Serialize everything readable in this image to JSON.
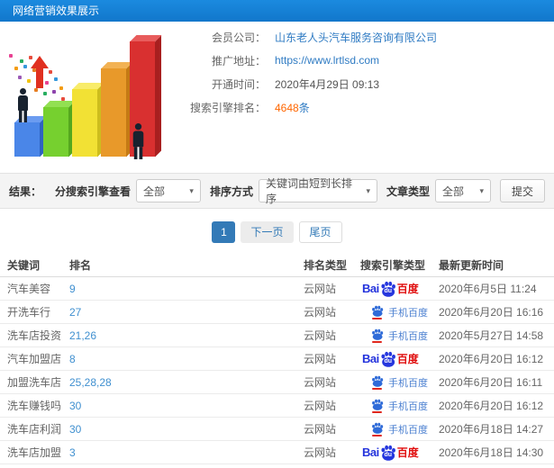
{
  "header": {
    "title": "网络营销效果展示"
  },
  "info": {
    "member": {
      "label": "会员公司：",
      "value": "山东老人头汽车服务咨询有限公司"
    },
    "url": {
      "label": "推广地址：",
      "value": "https://www.lrtlsd.com"
    },
    "open_time": {
      "label": "开通时间：",
      "value": "2020年4月29日 09:13"
    },
    "rank": {
      "label": "搜索引擎排名：",
      "value": "4648",
      "unit": "条"
    }
  },
  "filters": {
    "section_label": "结果：",
    "engine": {
      "label": "分搜索引擎查看",
      "selected": "全部"
    },
    "sort": {
      "label": "排序方式",
      "selected": "关键词由短到长排序"
    },
    "article": {
      "label": "文章类型",
      "selected": "全部"
    },
    "submit_label": "提交",
    "caret": "▾"
  },
  "pagination": {
    "current": "1",
    "next_label": "下一页",
    "last_label": "尾页"
  },
  "logos": {
    "baidu": {
      "bai": "Bai",
      "du": "du",
      "cn": "百度"
    },
    "mobile_baidu": {
      "label": "手机百度"
    }
  },
  "colors": {
    "header_blue": "#1581d6",
    "link_blue": "#2f7bc3",
    "accent_orange": "#ff6600",
    "baidu_blue": "#2433dc",
    "baidu_red": "#e00d0d",
    "active_page_blue": "#337ab7"
  },
  "table": {
    "columns": [
      "关键词",
      "排名",
      "排名类型",
      "搜索引擎类型",
      "最新更新时间"
    ],
    "rows": [
      {
        "keyword": "汽车美容",
        "rank": "9",
        "rank_type": "云网站",
        "engine": "baidu",
        "updated": "2020年6月5日 11:24"
      },
      {
        "keyword": "开洗车行",
        "rank": "27",
        "rank_type": "云网站",
        "engine": "mobile-baidu",
        "updated": "2020年6月20日 16:16"
      },
      {
        "keyword": "洗车店投资",
        "rank": "21,26",
        "rank_type": "云网站",
        "engine": "mobile-baidu",
        "updated": "2020年5月27日 14:58"
      },
      {
        "keyword": "汽车加盟店",
        "rank": "8",
        "rank_type": "云网站",
        "engine": "baidu",
        "updated": "2020年6月20日 16:12"
      },
      {
        "keyword": "加盟洗车店",
        "rank": "25,28,28",
        "rank_type": "云网站",
        "engine": "mobile-baidu",
        "updated": "2020年6月20日 16:11"
      },
      {
        "keyword": "洗车赚钱吗",
        "rank": "30",
        "rank_type": "云网站",
        "engine": "mobile-baidu",
        "updated": "2020年6月20日 16:12"
      },
      {
        "keyword": "洗车店利润",
        "rank": "30",
        "rank_type": "云网站",
        "engine": "mobile-baidu",
        "updated": "2020年6月18日 14:27"
      },
      {
        "keyword": "洗车店加盟",
        "rank": "3",
        "rank_type": "云网站",
        "engine": "baidu",
        "updated": "2020年6月18日 14:30"
      }
    ]
  }
}
